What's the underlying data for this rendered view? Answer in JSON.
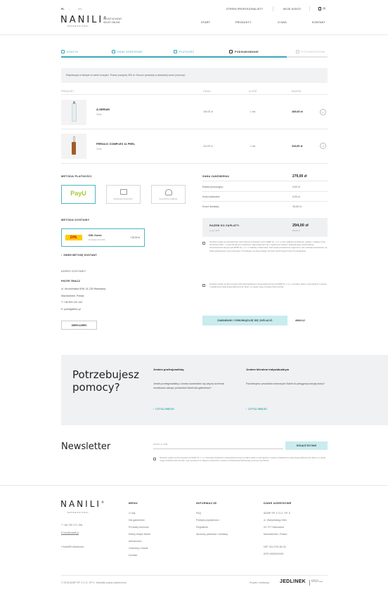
{
  "header": {
    "lang_pl": "PL",
    "lang_en": "EN",
    "logo": "NANIL",
    "logo_sub": "PROFESSIONAL",
    "tagline_line1": "WEJDŹ W NOWY",
    "tagline_line2": "SKLEP ONLINE",
    "top_links": [
      "STREFA PROFESJONALISTY",
      "MOJE KONTO"
    ],
    "cart_count": "(3)",
    "nav": [
      "START",
      "PRODUKTY",
      "O NAS",
      "KONTAKT"
    ]
  },
  "steps": [
    {
      "label": "KOSZYK",
      "state": "done"
    },
    {
      "label": "DANE ADRESOWE",
      "state": "done"
    },
    {
      "label": "PŁATNOŚĆ",
      "state": "done"
    },
    {
      "label": "PODSUMOWANIE",
      "state": "active"
    },
    {
      "label": "POTWIERDZENIE",
      "state": "todo"
    }
  ],
  "notice": "Rejestracja w sklepie to wiele korzyści. Pokaż powyżej 300 zł. Dorzuć produkty w aktualnej cenie promocji.",
  "table": {
    "headers": [
      "PRODUKT",
      "CENA",
      "ILOŚĆ",
      "RAZEM"
    ],
    "rows": [
      {
        "name": "A-SERUM",
        "sub": "30ml",
        "price": "169,00 zł",
        "qty": "1 szt.",
        "total": "169,00 zł"
      },
      {
        "name": "FERULIC COMPLEX 11 PEEL",
        "sub": "10ml",
        "price": "110,00 zł",
        "qty": "1 szt.",
        "total": "110,00 zł"
      }
    ]
  },
  "payment": {
    "title": "METODA PŁATNOŚCI",
    "options": [
      {
        "label": "PayU",
        "selected": true
      },
      {
        "label": "PRZELEW BANKOWY",
        "selected": false
      },
      {
        "label": "PŁATNOŚĆ ODBIÓR",
        "selected": false
      }
    ]
  },
  "shipping": {
    "title": "METODA DOSTAWY",
    "carrier": "DHL",
    "name": "DHL Kurier",
    "desc": "Dostawa 24h-48h",
    "price": "+15,00 zł",
    "change_link": "ZMIEŃ METODĘ DOSTAWY"
  },
  "address": {
    "title": "ADRES DOSTAWY:",
    "name": "PIOTR TRACZ",
    "lines": [
      "ul. Jerozolimska 8/36, 01-230 Warszawa,",
      "Mazowieckie, Polska",
      "T: +48 503 123 134",
      "E: piotr@jeffrec.pl"
    ],
    "button": "ZMIEŃ ADRES"
  },
  "summary": {
    "order_label": "SUMA ZAMÓWIENIA",
    "order_value": "279,00 zł",
    "rows": [
      {
        "label": "Rabat promocyjny:",
        "value": "0,00 zł"
      },
      {
        "label": "Koszt płatności:",
        "value": "0,00 zł"
      },
      {
        "label": "Koszt dostawy:",
        "value": "15,00 zł"
      }
    ],
    "total_label": "RAZEM DO ZAPŁATY:",
    "total_sub": "w tym VAT",
    "total_value": "294,00 zł",
    "vat_value": "58,80 zł"
  },
  "consents": [
    "Wyrażam zgodę na przetwarzanie moich danych osobowych przez ADMP Sp. z o.o. w celu realizacji zamówienia, zgodnie z ustawą z dnia 29 sierpnia 1997 r. o ochronie danych osobowych. Zapoznałem/am się z regulaminem sklepu i akceptuję jego postanowienia. Administratorem danych jest ADMP Sp. z o.o. z siedzibą w Warszawie. Dane będą przetwarzane wyłącznie w celu realizacji zamówienia i nie będą udostępniane innym podmiotom. Przysługuje mi prawo dostępu do treści swoich danych oraz ich poprawiania.",
    "Wyrażam zgodę na otrzymywanie informacji handlowych drogą elektroniczną od ADMP Sp. z o.o. na podany adres e-mail zgodnie z ustawą o świadczeniu usług drogą elektroniczną. Wiem, że zgodę mogę w każdej chwili wycofać."
  ],
  "order_button": "ZAMAWIAM I ZOBOWIĄZUJĘ SIĘ ZAPŁACIĆ",
  "cancel_button": "ANULUJ",
  "help": {
    "title_line1": "Potrzebujesz",
    "title_line2": "pomocy?",
    "cols": [
      {
        "head": "Jestem profesjonalistą",
        "text": "Jesteś profesjonalistką i chcesz dowiedzieć się więcej na temat możliwości zakupu produktów Nanili dla gabinetów?",
        "link": "CZYTAJ WIĘCEJ"
      },
      {
        "head": "Jestem klientem indywidualnym",
        "text": "Potrzebujesz produktów domowych Nanili do pielęgnacji swojej skóry?",
        "link": "CZYTAJ WIĘCEJ"
      }
    ]
  },
  "newsletter": {
    "title": "Newsletter",
    "placeholder": "Adres e-mail",
    "button": "DOŁĄCZ DO NAS",
    "consent": "Wyrażam zgodę na otrzymywanie od ADMP Sp. z o.o. informacji handlowych drogą elektroniczną na podany adres e-mail zgodnie z ustawą o świadczeniu usług drogą elektroniczną. Wiem, że zgodę mogę w każdej chwili wycofać, a jej wycofanie nie wpływa na zgodność z prawem przetwarzania dokonanego przed jej wycofaniem."
  },
  "footer": {
    "logo": "NANIL",
    "logo_sub": "PROFESSIONAL",
    "phone": "T +48 790 271 156",
    "email": "E info@nanili.pl",
    "social": "f /NaniliProfessional",
    "menu_head": "MENU",
    "menu": [
      "O nas",
      "Dla gabinetów",
      "Produkty domowe",
      "Efekty terapii Nanili",
      "Aktualności",
      "Gabinety z Nanili",
      "Kontakt"
    ],
    "info_head": "INFORMACJE",
    "info": [
      "FAQ",
      "Polityka prywatności",
      "Regulamin",
      "Sposoby płatności i dostawy"
    ],
    "addr_head": "DANE ADRESOWE",
    "addr": [
      "ADMP SP. Z O.O. SP. K",
      "ul. Waryńskiego 58A",
      "02-727 Warszawa",
      "Mazowieckie, Polska",
      "",
      "NIP: 521-378-38-33",
      "KRS 0000491009"
    ],
    "copyright": "© 2018 ADMP SP. Z O.O. SP. K. Wszelkie prawa zastrzeżone.",
    "credit_label": "Projekt i realizacja:",
    "credit_brand": "JEDLINEK",
    "credit_sub": "AGENCJA INTERAKTYWNA"
  },
  "colors": {
    "accent": "#3aa9b5",
    "accent_light": "#c9ecef",
    "panel": "#f0f1f2"
  }
}
